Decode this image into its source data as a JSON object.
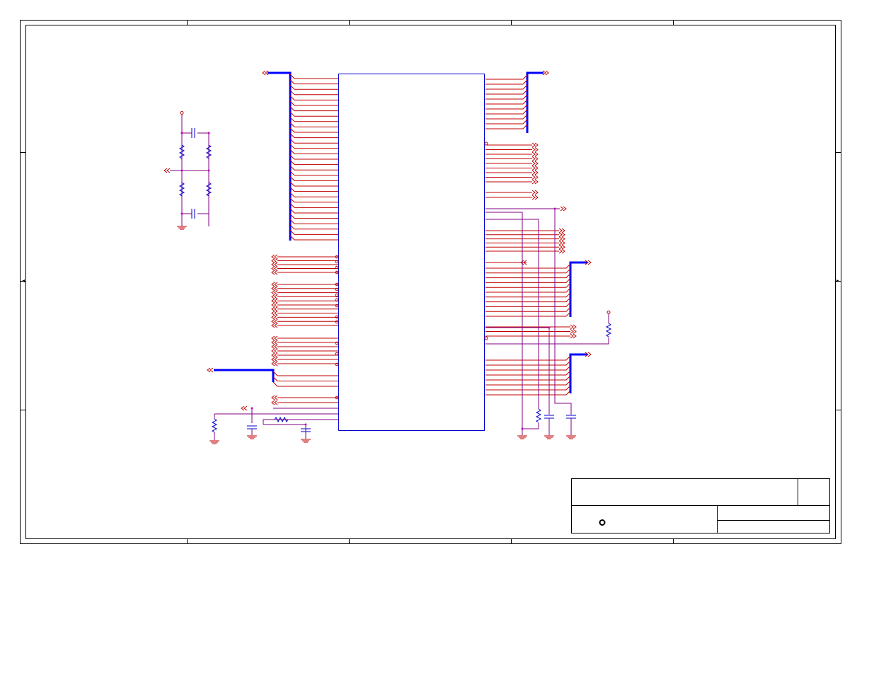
{
  "title_block": {
    "title": "",
    "sheet": "",
    "company": "",
    "size": "",
    "revision": ""
  },
  "colors": {
    "frame": "#000000",
    "net_wire": "#c00000",
    "power_wire": "#800080",
    "bus": "#0000ff",
    "component": "#0000cc",
    "junction": "#c000c0"
  },
  "icons": {
    "port": "double-chevron-port",
    "ground": "ground-symbol",
    "power": "power-pin-circle"
  }
}
